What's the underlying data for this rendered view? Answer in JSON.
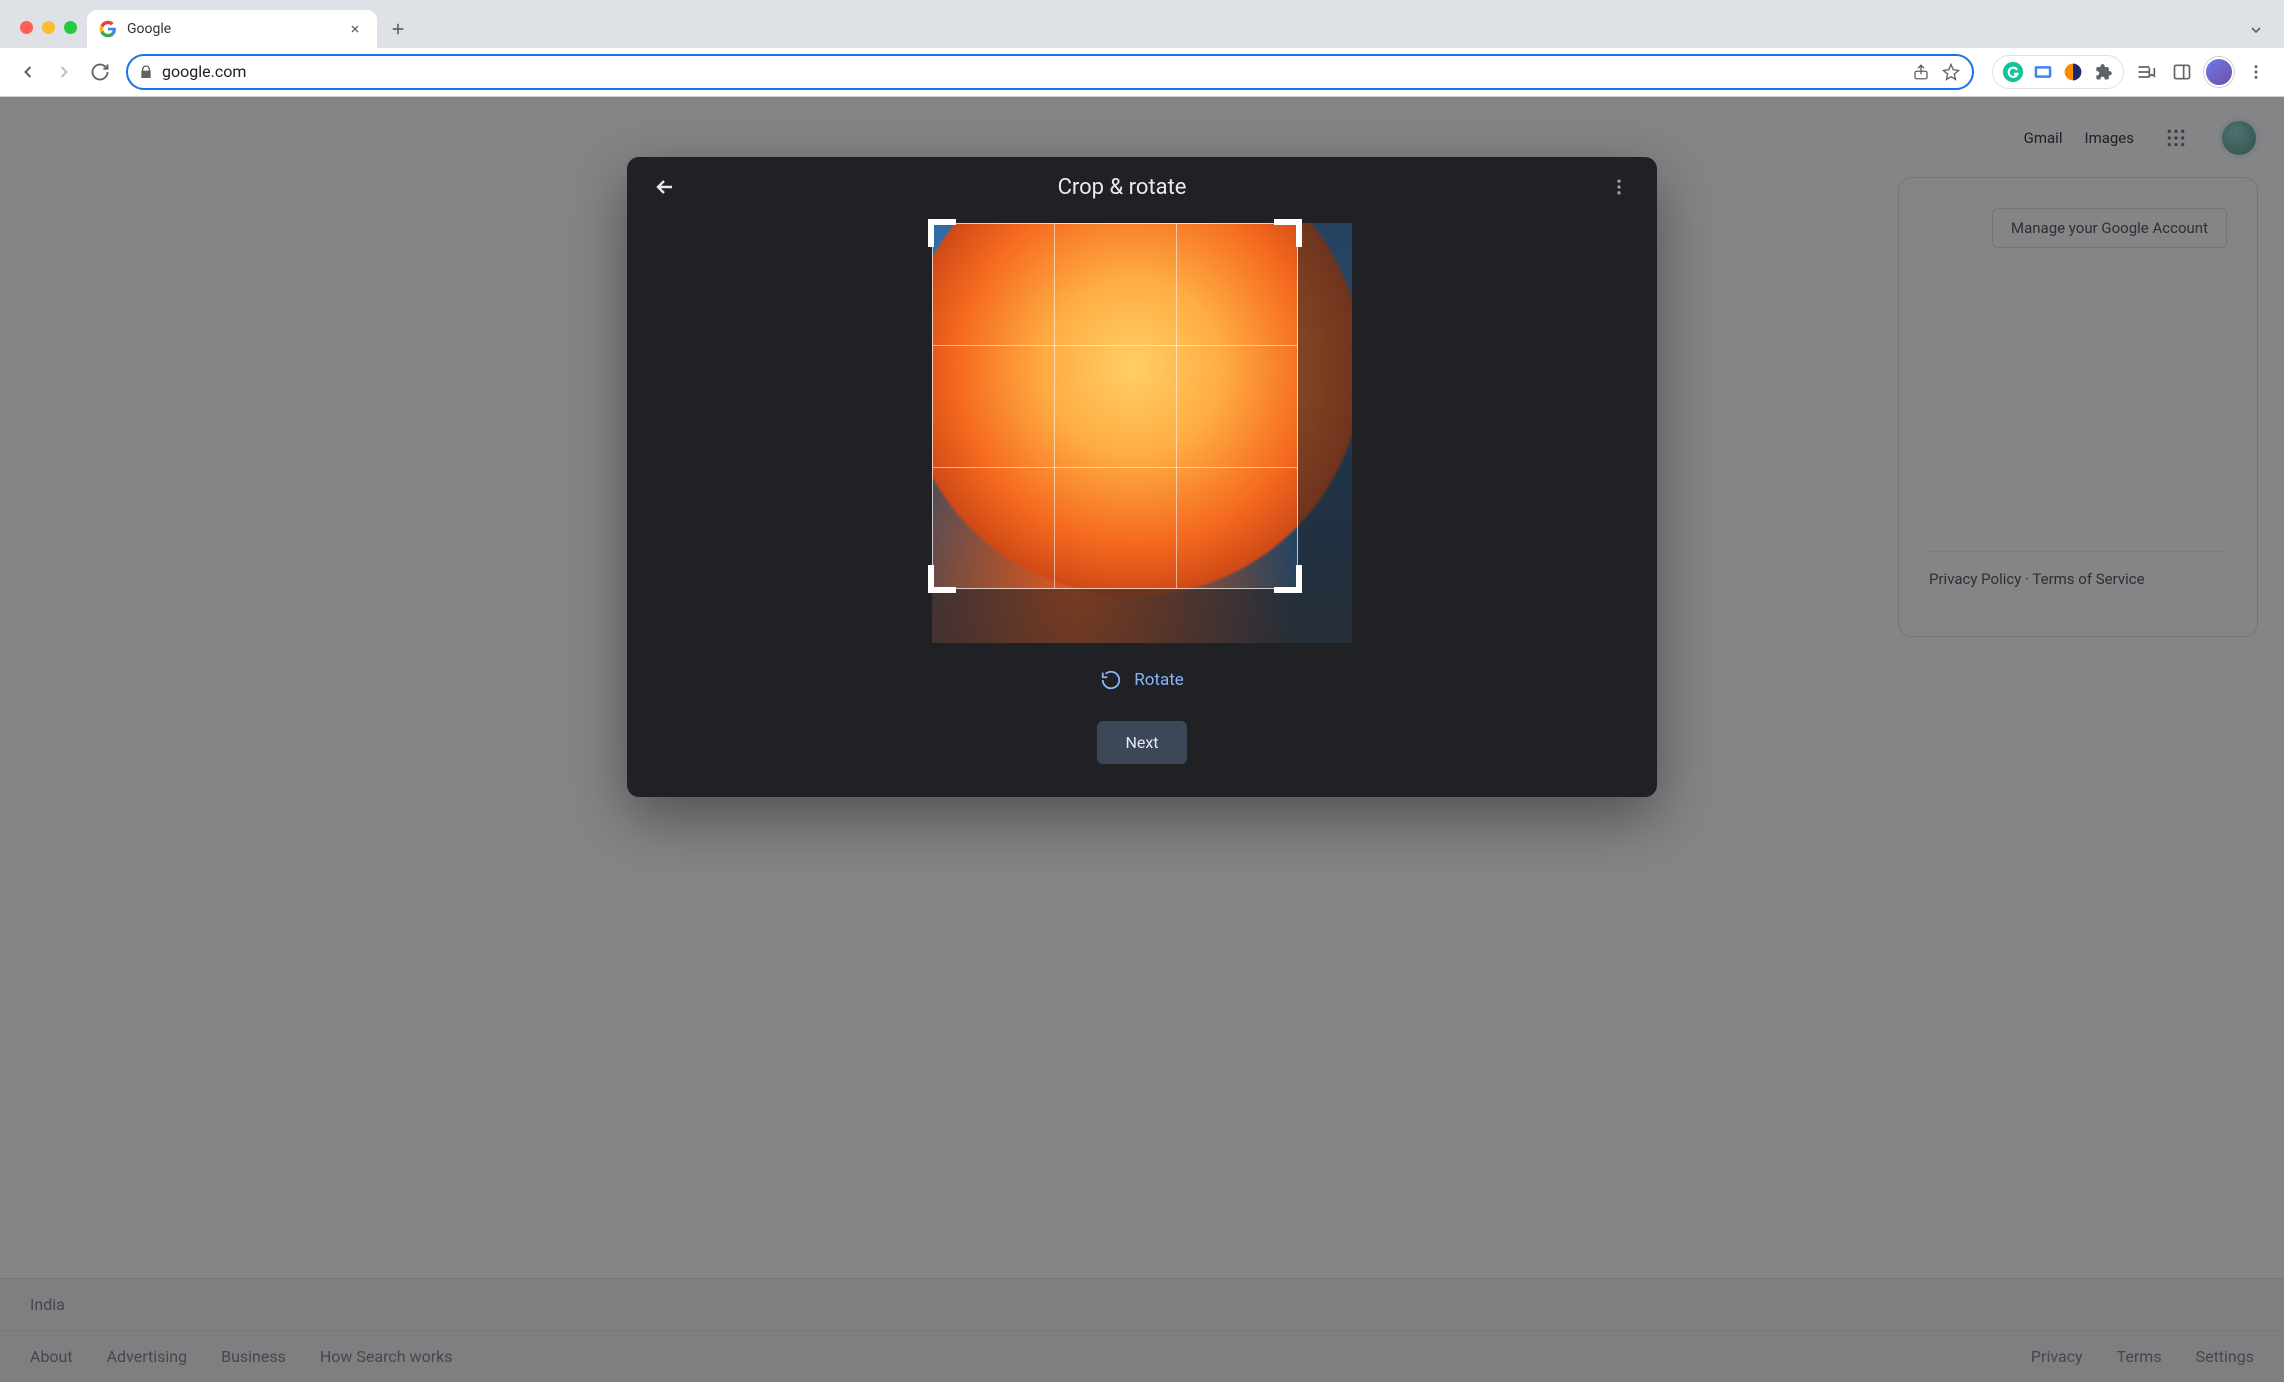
{
  "window": {
    "tab_title": "Google",
    "url": "google.com"
  },
  "header": {
    "gmail": "Gmail",
    "images": "Images"
  },
  "account": {
    "manage": "Manage your Google Account",
    "tos": "Privacy Policy · Terms of Service"
  },
  "footer": {
    "country": "India",
    "left": [
      "About",
      "Advertising",
      "Business",
      "How Search works"
    ],
    "right": [
      "Privacy",
      "Terms",
      "Settings"
    ]
  },
  "modal": {
    "title": "Crop & rotate",
    "rotate": "Rotate",
    "next": "Next"
  }
}
